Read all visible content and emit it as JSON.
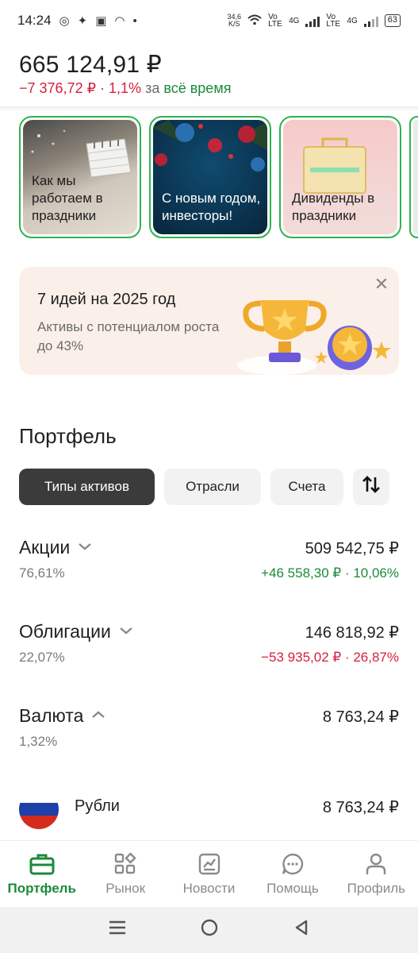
{
  "status_bar": {
    "time": "14:24",
    "speed": "34,6",
    "speed_unit": "K/S",
    "sim1": "Vo LTE",
    "sim1_type": "4G",
    "sim2": "Vo LTE",
    "sim2_type": "4G",
    "battery": "63"
  },
  "header": {
    "total": "665 124,91 ₽",
    "change_value": "−7 376,72 ₽ · 1,1%",
    "change_period_prefix": "за",
    "change_period": "всё время"
  },
  "stories": [
    {
      "text": "Как мы работаем в праздники"
    },
    {
      "text": "С новым годом, инвесторы!"
    },
    {
      "text": "Дивиденды в праздники"
    },
    {
      "text": ""
    }
  ],
  "banner": {
    "title": "7 идей на 2025 год",
    "text": "Активы с потенциалом роста до 43%",
    "close": "✕"
  },
  "portfolio": {
    "title": "Портфель",
    "chips": [
      "Типы активов",
      "Отрасли",
      "Счета"
    ],
    "assets": [
      {
        "name": "Акции",
        "share": "76,61%",
        "value": "509 542,75 ₽",
        "delta": "+46 558,30 ₽ · 10,06%",
        "direction": "pos",
        "expanded": false
      },
      {
        "name": "Облигации",
        "share": "22,07%",
        "value": "146 818,92 ₽",
        "delta": "−53 935,02 ₽ · 26,87%",
        "direction": "neg",
        "expanded": false
      },
      {
        "name": "Валюта",
        "share": "1,32%",
        "value": "8 763,24 ₽",
        "delta": "",
        "direction": "none",
        "expanded": true
      }
    ],
    "sub_assets": [
      {
        "name": "Рубли",
        "value": "8 763,24 ₽",
        "flag_colors": [
          "#ffffff",
          "#1c3faa",
          "#d52b1e"
        ]
      }
    ]
  },
  "bottom_nav": [
    {
      "label": "Портфель",
      "icon": "briefcase-icon",
      "active": true
    },
    {
      "label": "Рынок",
      "icon": "market-grid-icon",
      "active": false
    },
    {
      "label": "Новости",
      "icon": "news-chart-icon",
      "active": false
    },
    {
      "label": "Помощь",
      "icon": "chat-bubble-icon",
      "active": false
    },
    {
      "label": "Профиль",
      "icon": "person-icon",
      "active": false
    }
  ],
  "colors": {
    "accent_green": "#1b8a3b",
    "negative_red": "#d6213a",
    "story_border": "#2eb34d"
  }
}
